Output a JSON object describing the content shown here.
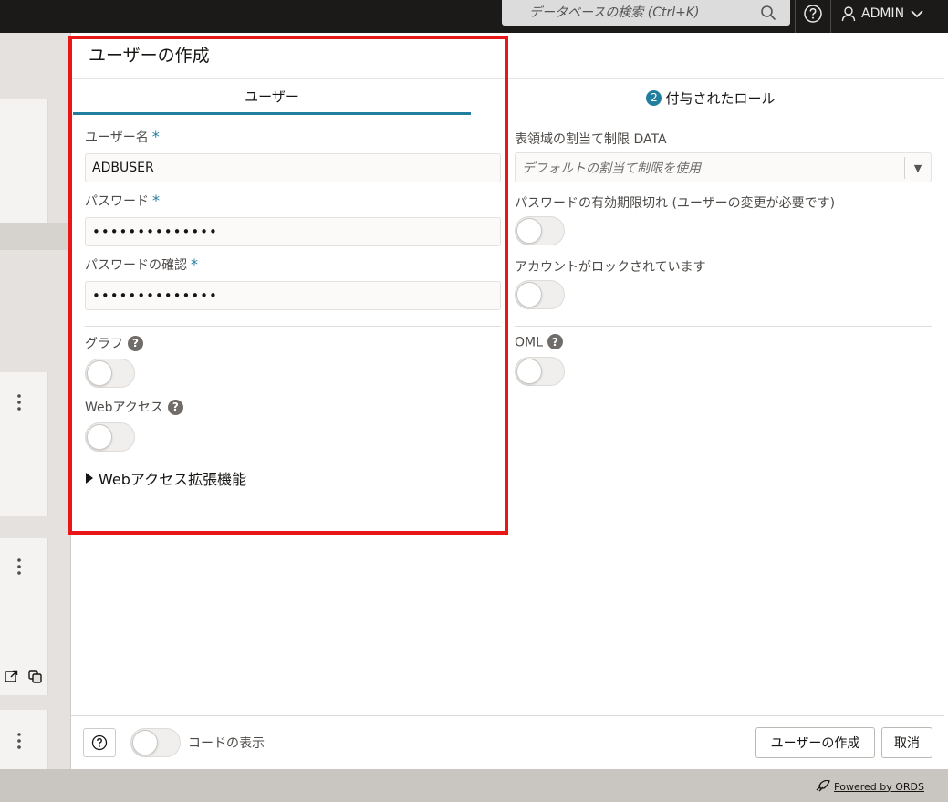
{
  "topbar": {
    "search_placeholder": "データベースの検索 (Ctrl+K)",
    "user_name": "ADMIN"
  },
  "drawer": {
    "title": "ユーザーの作成",
    "tabs": [
      {
        "label": "ユーザー",
        "active": true
      },
      {
        "label": "付与されたロール",
        "badge": "2",
        "active": false
      }
    ],
    "fields": {
      "username_label": "ユーザー名",
      "username_value": "ADBUSER",
      "password_label": "パスワード",
      "password_value": "••••••••••••••",
      "confirm_label": "パスワードの確認",
      "confirm_value": "••••••••••••••",
      "required_mark": "*",
      "quota_label": "表領域の割当て制限 DATA",
      "quota_value": "デフォルトの割当て制限を使用",
      "pw_expire_label": "パスワードの有効期限切れ (ユーザーの変更が必要です)",
      "locked_label": "アカウントがロックされています",
      "graph_label": "グラフ",
      "oml_label": "OML",
      "web_access_label": "Webアクセス",
      "help_mark": "?"
    },
    "toggles": {
      "pw_expire": false,
      "locked": false,
      "graph": false,
      "oml": false,
      "web_access": false,
      "show_code": false
    },
    "expander_label": "Webアクセス拡張機能",
    "footer": {
      "show_code_label": "コードの表示",
      "create_button": "ユーザーの作成",
      "cancel_button": "取消"
    }
  },
  "page_footer": {
    "powered_by": "Powered by ORDS"
  },
  "colors": {
    "accent": "#227e9e",
    "highlight_box": "#e81616",
    "topbar": "#1b1a19"
  }
}
